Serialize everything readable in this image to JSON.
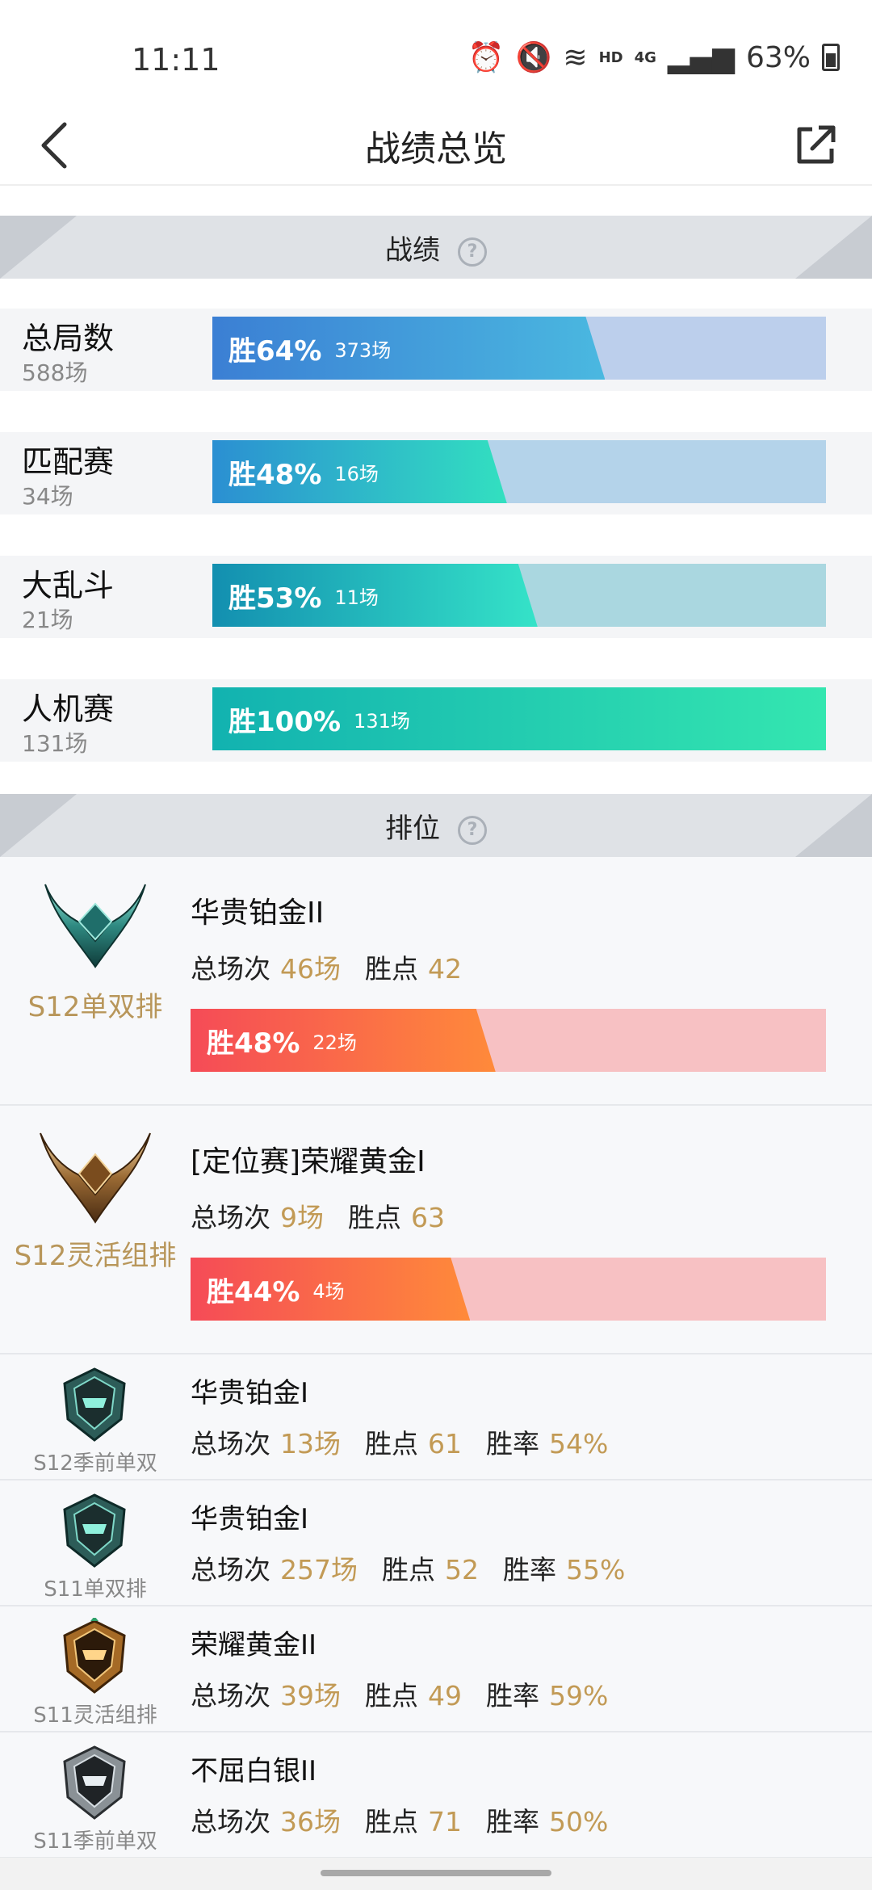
{
  "status_bar": {
    "time": "11:11",
    "network": "HD",
    "network2": "4G",
    "battery": "63%"
  },
  "header": {
    "title": "战绩总览"
  },
  "record_section": {
    "title": "战绩"
  },
  "records": [
    {
      "label": "总局数",
      "sub": "588场",
      "win_label": "胜64%",
      "win_count": "373场",
      "win_fraction": 0.64
    },
    {
      "label": "匹配赛",
      "sub": "34场",
      "win_label": "胜48%",
      "win_count": "16场",
      "win_fraction": 0.48
    },
    {
      "label": "大乱斗",
      "sub": "21场",
      "win_label": "胜53%",
      "win_count": "11场",
      "win_fraction": 0.53
    },
    {
      "label": "人机赛",
      "sub": "131场",
      "win_label": "胜100%",
      "win_count": "131场",
      "win_fraction": 1.0
    }
  ],
  "rank_section": {
    "title": "排位"
  },
  "ranks_big": [
    {
      "queue": "S12单双排",
      "tier": "华贵铂金II",
      "games_label": "总场次",
      "games": "46场",
      "lp_label": "胜点",
      "lp": "42",
      "win_label": "胜48%",
      "win_count": "22场",
      "win_fraction": 0.48,
      "emblem": "platinum-emblem-icon"
    },
    {
      "queue": "S12灵活组排",
      "tier": "[定位赛]荣耀黄金I",
      "games_label": "总场次",
      "games": "9场",
      "lp_label": "胜点",
      "lp": "63",
      "win_label": "胜44%",
      "win_count": "4场",
      "win_fraction": 0.44,
      "emblem": "gold-emblem-icon"
    }
  ],
  "ranks_small": [
    {
      "queue": "S12季前单双",
      "tier": "华贵铂金I",
      "games_label": "总场次",
      "games": "13场",
      "lp_label": "胜点",
      "lp": "61",
      "rate_label": "胜率",
      "rate": "54%",
      "emblem": "platinum-helmet-icon"
    },
    {
      "queue": "S11单双排",
      "tier": "华贵铂金I",
      "games_label": "总场次",
      "games": "257场",
      "lp_label": "胜点",
      "lp": "52",
      "rate_label": "胜率",
      "rate": "55%",
      "emblem": "platinum-helmet-icon"
    },
    {
      "queue": "S11灵活组排",
      "tier": "荣耀黄金II",
      "games_label": "总场次",
      "games": "39场",
      "lp_label": "胜点",
      "lp": "49",
      "rate_label": "胜率",
      "rate": "59%",
      "emblem": "gold-helmet-icon"
    },
    {
      "queue": "S11季前单双",
      "tier": "不屈白银II",
      "games_label": "总场次",
      "games": "36场",
      "lp_label": "胜点",
      "lp": "71",
      "rate_label": "胜率",
      "rate": "50%",
      "emblem": "silver-helmet-icon"
    }
  ],
  "colors": {
    "accent_gold": "#c29a55",
    "bar_blue_from": "#3b7fd4",
    "bar_blue_to": "#4ab8e0",
    "bar_blue_bg": "#bccfec",
    "bar_teal_from": "#2b8fd2",
    "bar_teal_to": "#32e0c0",
    "bar_teal_bg": "#b4d3ea",
    "bar_cyan_from": "#138fb0",
    "bar_cyan_to": "#35e3c8",
    "bar_cyan_bg": "#aad7e0",
    "bar_green_from": "#12b2b0",
    "bar_green_to": "#34e6b0",
    "rank_bar_from": "#f54b57",
    "rank_bar_to": "#ff8a3a",
    "rank_bar_bg": "#f7c1c3"
  }
}
